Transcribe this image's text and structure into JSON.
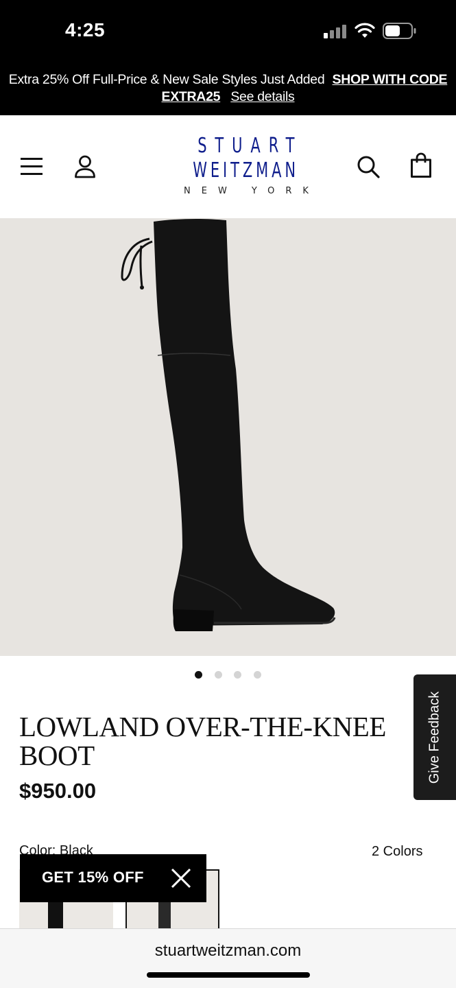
{
  "status_bar": {
    "time": "4:25",
    "icons": [
      "signal-icon",
      "wifi-icon",
      "battery-icon"
    ]
  },
  "promo": {
    "text": "Extra 25% Off Full-Price & New Sale Styles Just Added",
    "code_link": "SHOP WITH CODE EXTRA25",
    "details_link": "See details"
  },
  "header": {
    "logo_line1": "STUART",
    "logo_line2": "WEITZMAN",
    "logo_line3": "NEW YORK",
    "icons": [
      "menu-icon",
      "account-icon",
      "search-icon",
      "bag-icon"
    ],
    "brand_color": "#0f1e8c"
  },
  "product": {
    "image_alt": "black suede over-the-knee boot",
    "carousel_total": 4,
    "carousel_active": 1,
    "title": "LOWLAND OVER-THE-KNEE BOOT",
    "price": "$950.00",
    "color_label": "Color: Black",
    "color_count": "2 Colors"
  },
  "feedback": {
    "label": "Give Feedback"
  },
  "discount_popup": {
    "label": "GET 15% OFF",
    "close_icon": "close-icon"
  },
  "browser": {
    "url": "stuartweitzman.com"
  }
}
